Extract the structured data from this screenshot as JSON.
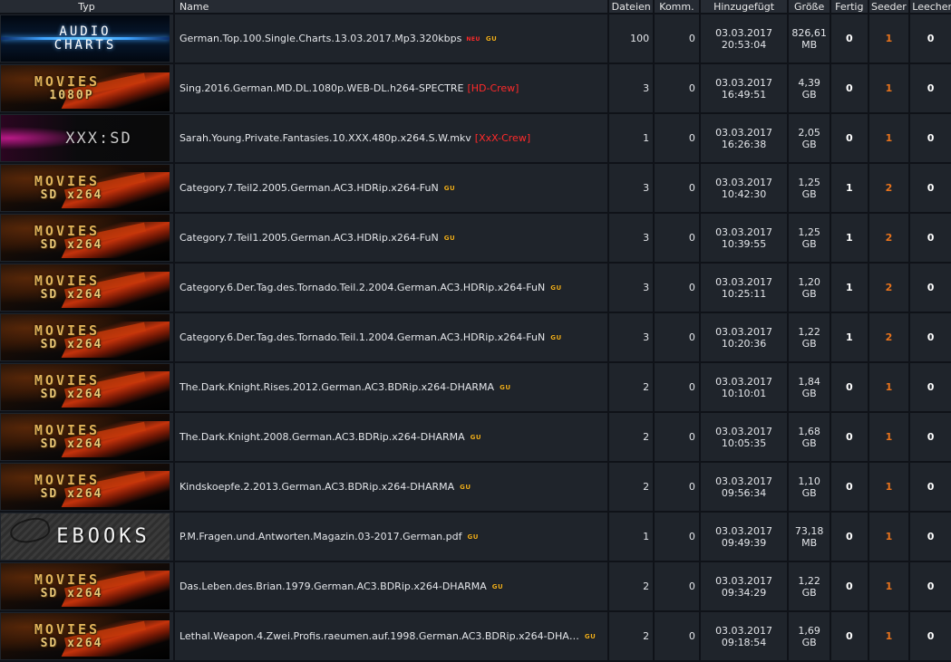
{
  "columns": {
    "typ": "Typ",
    "name": "Name",
    "dateien": "Dateien",
    "komm": "Komm.",
    "hinzugefuegt": "Hinzugefügt",
    "groesse": "Größe",
    "fertig": "Fertig",
    "seeder": "Seeder",
    "leecher": "Leecher"
  },
  "rows": [
    {
      "banner": {
        "kind": "audio",
        "line1": "AUDIO",
        "line2": "CHARTS"
      },
      "name": "German.Top.100.Single.Charts.13.03.2017.Mp3.320kbps",
      "tag": "",
      "new_badge": "NEU",
      "badge": "GU",
      "files": "100",
      "comments": "0",
      "date": "03.03.2017",
      "time": "20:53:04",
      "size": "826,61",
      "unit": "MB",
      "finished": "0",
      "seeder": "1",
      "leecher": "0"
    },
    {
      "banner": {
        "kind": "movies",
        "line1": "MOVIES",
        "line2": "1080P"
      },
      "name": "Sing.2016.German.MD.DL.1080p.WEB-DL.h264-SPECTRE",
      "tag": "[HD-Crew]",
      "new_badge": "",
      "badge": "",
      "files": "3",
      "comments": "0",
      "date": "03.03.2017",
      "time": "16:49:51",
      "size": "4,39",
      "unit": "GB",
      "finished": "0",
      "seeder": "1",
      "leecher": "0"
    },
    {
      "banner": {
        "kind": "xxx",
        "line1": "XXX:SD",
        "line2": ""
      },
      "name": "Sarah.Young.Private.Fantasies.10.XXX.480p.x264.S.W.mkv",
      "tag": "[XxX-Crew]",
      "new_badge": "",
      "badge": "",
      "files": "1",
      "comments": "0",
      "date": "03.03.2017",
      "time": "16:26:38",
      "size": "2,05",
      "unit": "GB",
      "finished": "0",
      "seeder": "1",
      "leecher": "0"
    },
    {
      "banner": {
        "kind": "movies",
        "line1": "MOVIES",
        "line2": "SD x264"
      },
      "name": "Category.7.Teil2.2005.German.AC3.HDRip.x264-FuN",
      "tag": "",
      "new_badge": "",
      "badge": "GU",
      "files": "3",
      "comments": "0",
      "date": "03.03.2017",
      "time": "10:42:30",
      "size": "1,25",
      "unit": "GB",
      "finished": "1",
      "seeder": "2",
      "leecher": "0"
    },
    {
      "banner": {
        "kind": "movies",
        "line1": "MOVIES",
        "line2": "SD x264"
      },
      "name": "Category.7.Teil1.2005.German.AC3.HDRip.x264-FuN",
      "tag": "",
      "new_badge": "",
      "badge": "GU",
      "files": "3",
      "comments": "0",
      "date": "03.03.2017",
      "time": "10:39:55",
      "size": "1,25",
      "unit": "GB",
      "finished": "1",
      "seeder": "2",
      "leecher": "0"
    },
    {
      "banner": {
        "kind": "movies",
        "line1": "MOVIES",
        "line2": "SD x264"
      },
      "name": "Category.6.Der.Tag.des.Tornado.Teil.2.2004.German.AC3.HDRip.x264-FuN",
      "tag": "",
      "new_badge": "",
      "badge": "GU",
      "files": "3",
      "comments": "0",
      "date": "03.03.2017",
      "time": "10:25:11",
      "size": "1,20",
      "unit": "GB",
      "finished": "1",
      "seeder": "2",
      "leecher": "0"
    },
    {
      "banner": {
        "kind": "movies",
        "line1": "MOVIES",
        "line2": "SD x264"
      },
      "name": "Category.6.Der.Tag.des.Tornado.Teil.1.2004.German.AC3.HDRip.x264-FuN",
      "tag": "",
      "new_badge": "",
      "badge": "GU",
      "files": "3",
      "comments": "0",
      "date": "03.03.2017",
      "time": "10:20:36",
      "size": "1,22",
      "unit": "GB",
      "finished": "1",
      "seeder": "2",
      "leecher": "0"
    },
    {
      "banner": {
        "kind": "movies",
        "line1": "MOVIES",
        "line2": "SD x264"
      },
      "name": "The.Dark.Knight.Rises.2012.German.AC3.BDRip.x264-DHARMA",
      "tag": "",
      "new_badge": "",
      "badge": "GU",
      "files": "2",
      "comments": "0",
      "date": "03.03.2017",
      "time": "10:10:01",
      "size": "1,84",
      "unit": "GB",
      "finished": "0",
      "seeder": "1",
      "leecher": "0"
    },
    {
      "banner": {
        "kind": "movies",
        "line1": "MOVIES",
        "line2": "SD x264"
      },
      "name": "The.Dark.Knight.2008.German.AC3.BDRip.x264-DHARMA",
      "tag": "",
      "new_badge": "",
      "badge": "GU",
      "files": "2",
      "comments": "0",
      "date": "03.03.2017",
      "time": "10:05:35",
      "size": "1,68",
      "unit": "GB",
      "finished": "0",
      "seeder": "1",
      "leecher": "0"
    },
    {
      "banner": {
        "kind": "movies",
        "line1": "MOVIES",
        "line2": "SD x264"
      },
      "name": "Kindskoepfe.2.2013.German.AC3.BDRip.x264-DHARMA",
      "tag": "",
      "new_badge": "",
      "badge": "GU",
      "files": "2",
      "comments": "0",
      "date": "03.03.2017",
      "time": "09:56:34",
      "size": "1,10",
      "unit": "GB",
      "finished": "0",
      "seeder": "1",
      "leecher": "0"
    },
    {
      "banner": {
        "kind": "ebooks",
        "line1": "EBOOKS",
        "line2": ""
      },
      "name": "P.M.Fragen.und.Antworten.Magazin.03-2017.German.pdf",
      "tag": "",
      "new_badge": "",
      "badge": "GU",
      "files": "1",
      "comments": "0",
      "date": "03.03.2017",
      "time": "09:49:39",
      "size": "73,18",
      "unit": "MB",
      "finished": "0",
      "seeder": "1",
      "leecher": "0"
    },
    {
      "banner": {
        "kind": "movies",
        "line1": "MOVIES",
        "line2": "SD x264"
      },
      "name": "Das.Leben.des.Brian.1979.German.AC3.BDRip.x264-DHARMA",
      "tag": "",
      "new_badge": "",
      "badge": "GU",
      "files": "2",
      "comments": "0",
      "date": "03.03.2017",
      "time": "09:34:29",
      "size": "1,22",
      "unit": "GB",
      "finished": "0",
      "seeder": "1",
      "leecher": "0"
    },
    {
      "banner": {
        "kind": "movies",
        "line1": "MOVIES",
        "line2": "SD x264"
      },
      "name": "Lethal.Weapon.4.Zwei.Profis.raeumen.auf.1998.German.AC3.BDRip.x264-DHA…",
      "tag": "",
      "new_badge": "",
      "badge": "GU",
      "files": "2",
      "comments": "0",
      "date": "03.03.2017",
      "time": "09:18:54",
      "size": "1,69",
      "unit": "GB",
      "finished": "0",
      "seeder": "1",
      "leecher": "0"
    }
  ],
  "colors": {
    "background": "#0f1218",
    "row": "#1f242b",
    "header": "#262b33",
    "seeder": "#e8731c",
    "group_tag": "#ff2a2a",
    "gu_badge": "#f0b020"
  }
}
